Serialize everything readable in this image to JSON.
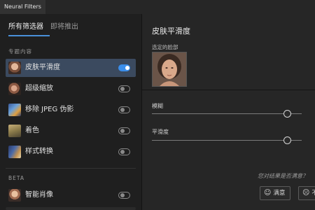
{
  "window": {
    "title": "Neural Filters"
  },
  "left": {
    "tabs": [
      "所有筛选器",
      "即将推出"
    ],
    "section_featured": "专题内容",
    "section_beta": "BETA",
    "filters": [
      {
        "label": "皮肤平滑度",
        "enabled": true,
        "selected": true
      },
      {
        "label": "超级缩放",
        "enabled": false,
        "selected": false
      },
      {
        "label": "移除 JPEG 伪影",
        "enabled": false,
        "selected": false
      },
      {
        "label": "着色",
        "enabled": false,
        "selected": false
      },
      {
        "label": "样式转换",
        "enabled": false,
        "selected": false
      }
    ],
    "beta_filters": [
      {
        "label": "智能肖像",
        "enabled": false
      }
    ]
  },
  "right": {
    "title": "皮肤平滑度",
    "selected_face_label": "选定的脸部",
    "sliders": [
      {
        "label": "模糊",
        "value": 0.9
      },
      {
        "label": "平滑度",
        "value": 0.9
      }
    ],
    "feedback_question": "您对结果是否满意？",
    "buttons": [
      {
        "icon": "smile-icon",
        "label": "满意"
      },
      {
        "icon": "frown-icon",
        "label": "不"
      }
    ]
  },
  "colors": {
    "accent": "#3b8eea",
    "selected_row": "#3b4a5f"
  }
}
